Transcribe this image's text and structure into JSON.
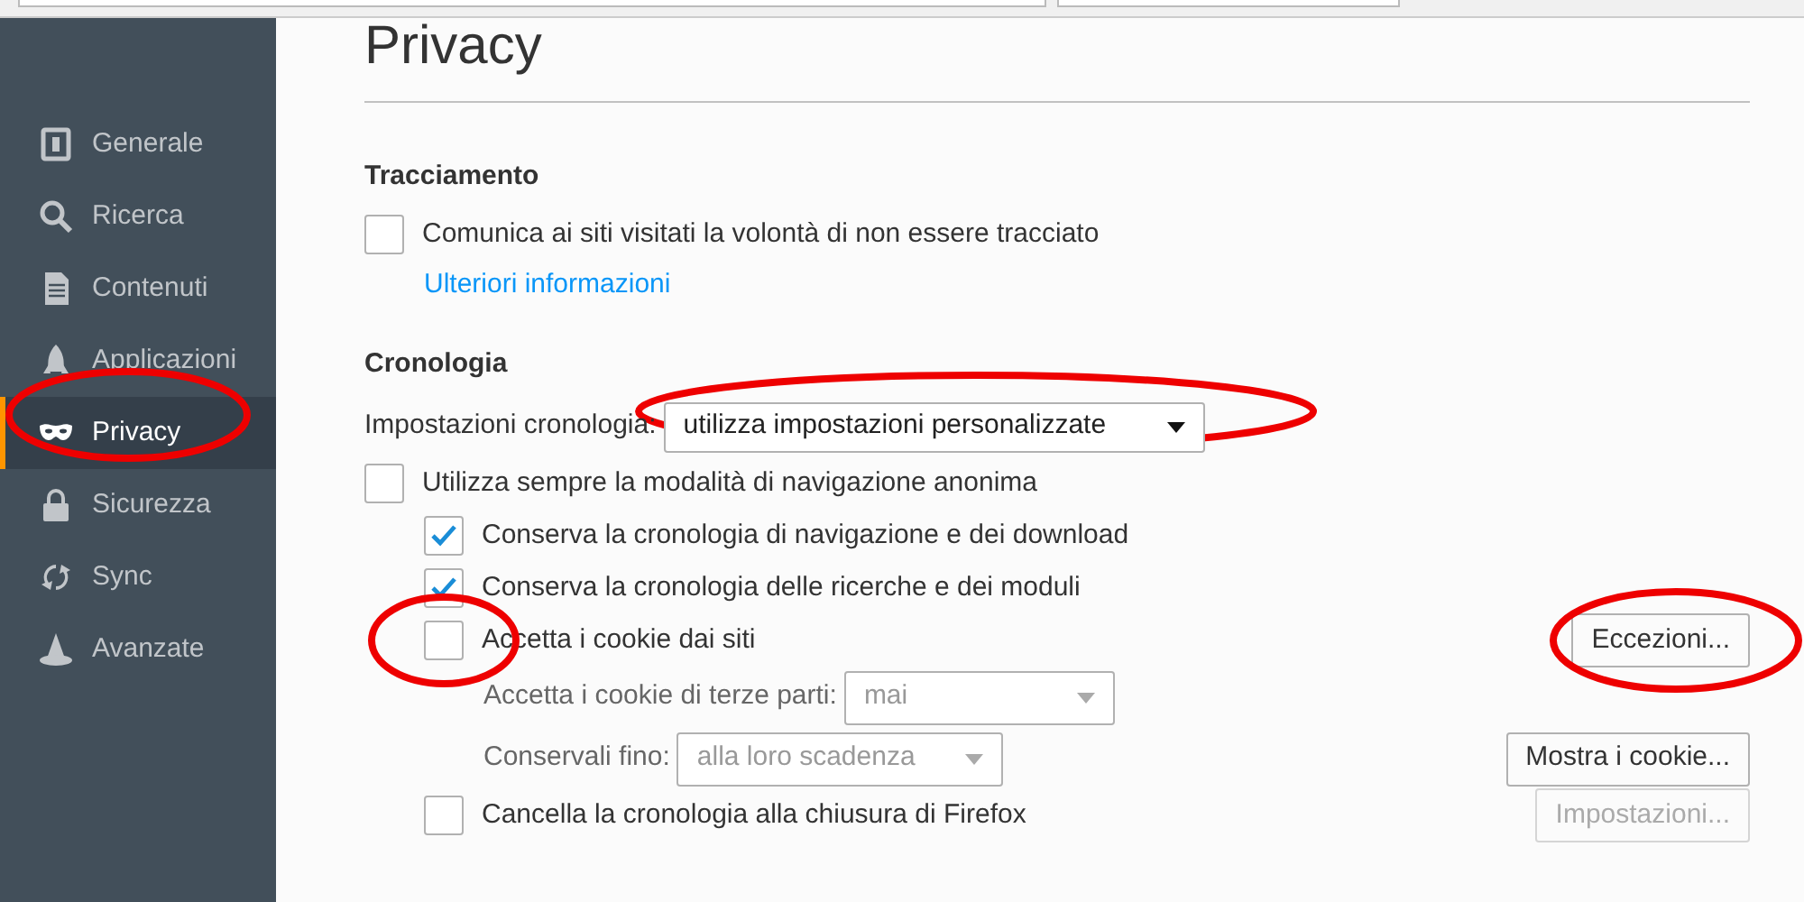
{
  "sidebar": {
    "items": [
      {
        "label": "Generale",
        "selected": false
      },
      {
        "label": "Ricerca",
        "selected": false
      },
      {
        "label": "Contenuti",
        "selected": false
      },
      {
        "label": "Applicazioni",
        "selected": false
      },
      {
        "label": "Privacy",
        "selected": true
      },
      {
        "label": "Sicurezza",
        "selected": false
      },
      {
        "label": "Sync",
        "selected": false
      },
      {
        "label": "Avanzate",
        "selected": false
      }
    ]
  },
  "page_title": "Privacy",
  "tracking": {
    "heading": "Tracciamento",
    "option": {
      "label": "Comunica ai siti visitati la volontà di non essere tracciato",
      "checked": false
    },
    "link": "Ulteriori informazioni"
  },
  "history": {
    "heading": "Cronologia",
    "setting_label": "Impostazioni cronologia:",
    "setting_value": "utilizza impostazioni personalizzate",
    "rows": [
      {
        "kind": "checkbox",
        "label": "Utilizza sempre la modalità di navigazione anonima",
        "checked": false,
        "children": [
          {
            "kind": "checkbox",
            "label": "Conserva la cronologia di navigazione e dei download",
            "checked": true
          },
          {
            "kind": "checkbox",
            "label": "Conserva la cronologia delle ricerche e dei moduli",
            "checked": true
          },
          {
            "kind": "checkbox",
            "label": "Accetta i cookie dai siti",
            "checked": false,
            "button": {
              "label": "Eccezioni...",
              "disabled": false
            },
            "children": [
              {
                "kind": "select",
                "label": "Accetta i cookie di terze parti:",
                "value": "mai",
                "disabled": true
              },
              {
                "kind": "select",
                "label": "Conservali fino:",
                "value": "alla loro scadenza",
                "disabled": true,
                "button": {
                  "label": "Mostra i cookie...",
                  "disabled": false
                }
              }
            ]
          },
          {
            "kind": "checkbox",
            "label": "Cancella la cronologia alla chiusura di Firefox",
            "checked": false,
            "button": {
              "label": "Impostazioni...",
              "disabled": true
            }
          }
        ]
      }
    ]
  }
}
